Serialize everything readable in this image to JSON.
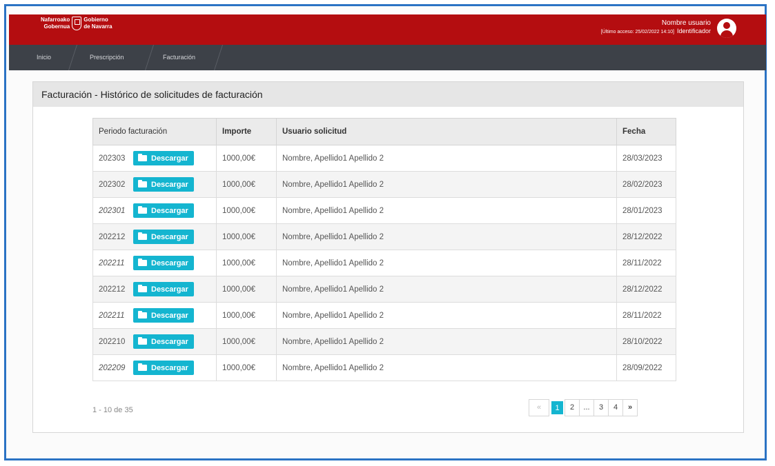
{
  "header": {
    "logo_left_line1": "Nafarroako",
    "logo_left_line2": "Gobernua",
    "logo_right_line1": "Gobierno",
    "logo_right_line2": "de Navarra",
    "user_name": "Nombre usuario",
    "last_access": "[Último acceso: 25/02/2022 14:10]",
    "identifier": "Identificador"
  },
  "nav": {
    "items": [
      {
        "label": "Inicio"
      },
      {
        "label": "Prescripción"
      },
      {
        "label": "Facturación"
      }
    ]
  },
  "panel": {
    "title": "Facturación - Histórico de solicitudes de facturación"
  },
  "table": {
    "columns": [
      "Periodo facturación",
      "Importe",
      "Usuario solicitud",
      "Fecha"
    ],
    "download_label": "Descargar",
    "rows": [
      {
        "periodo": "202303",
        "importe": "1000,00€",
        "usuario": "Nombre, Apellido1 Apellido 2",
        "fecha": "28/03/2023"
      },
      {
        "periodo": "202302",
        "importe": "1000,00€",
        "usuario": "Nombre, Apellido1 Apellido 2",
        "fecha": "28/02/2023"
      },
      {
        "periodo": "202301",
        "importe": "1000,00€",
        "usuario": "Nombre, Apellido1 Apellido 2",
        "fecha": "28/01/2023"
      },
      {
        "periodo": "202212",
        "importe": "1000,00€",
        "usuario": "Nombre, Apellido1 Apellido 2",
        "fecha": "28/12/2022"
      },
      {
        "periodo": "202211",
        "importe": "1000,00€",
        "usuario": "Nombre, Apellido1 Apellido 2",
        "fecha": "28/11/2022"
      },
      {
        "periodo": "202212",
        "importe": "1000,00€",
        "usuario": "Nombre, Apellido1 Apellido 2",
        "fecha": "28/12/2022"
      },
      {
        "periodo": "202211",
        "importe": "1000,00€",
        "usuario": "Nombre, Apellido1 Apellido 2",
        "fecha": "28/11/2022"
      },
      {
        "periodo": "202210",
        "importe": "1000,00€",
        "usuario": "Nombre, Apellido1 Apellido 2",
        "fecha": "28/10/2022"
      },
      {
        "periodo": "202209",
        "importe": "1000,00€",
        "usuario": "Nombre, Apellido1 Apellido 2",
        "fecha": "28/09/2022"
      }
    ]
  },
  "pagination": {
    "range_text": "1 - 10 de 35",
    "prev": "«",
    "pages": [
      "1",
      "2",
      "...",
      "3",
      "4"
    ],
    "next": "»",
    "active_page": "1"
  },
  "colors": {
    "brand_red": "#b40d10",
    "nav_dark": "#3d4148",
    "accent_cyan": "#14b5d0",
    "frame_blue": "#2b73c4"
  }
}
